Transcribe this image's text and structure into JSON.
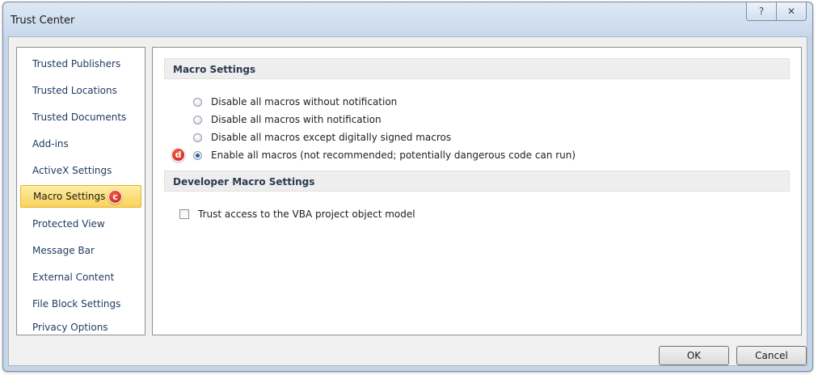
{
  "window": {
    "title": "Trust Center",
    "help_glyph": "?",
    "close_glyph": "✕"
  },
  "sidebar": {
    "items": [
      {
        "label": "Trusted Publishers"
      },
      {
        "label": "Trusted Locations"
      },
      {
        "label": "Trusted Documents"
      },
      {
        "label": "Add-ins"
      },
      {
        "label": "ActiveX Settings"
      },
      {
        "label": "Macro Settings",
        "selected": true,
        "marker": "c"
      },
      {
        "label": "Protected View"
      },
      {
        "label": "Message Bar"
      },
      {
        "label": "External Content"
      },
      {
        "label": "File Block Settings"
      },
      {
        "label": "Privacy Options"
      }
    ]
  },
  "macro_settings": {
    "header": "Macro Settings",
    "options": [
      {
        "label": "Disable all macros without notification",
        "checked": false
      },
      {
        "label": "Disable all macros with notification",
        "checked": false
      },
      {
        "label": "Disable all macros except digitally signed macros",
        "checked": false
      },
      {
        "label": "Enable all macros (not recommended; potentially dangerous code can run)",
        "checked": true,
        "marker": "d"
      }
    ]
  },
  "developer_settings": {
    "header": "Developer Macro Settings",
    "vba_label": "Trust access to the VBA project object model",
    "vba_checked": false
  },
  "buttons": {
    "ok": "OK",
    "cancel": "Cancel"
  },
  "colors": {
    "selection_fill": "#f9d25a",
    "marker_red": "#c3180c",
    "radio_checked": "#1f5fa8"
  }
}
